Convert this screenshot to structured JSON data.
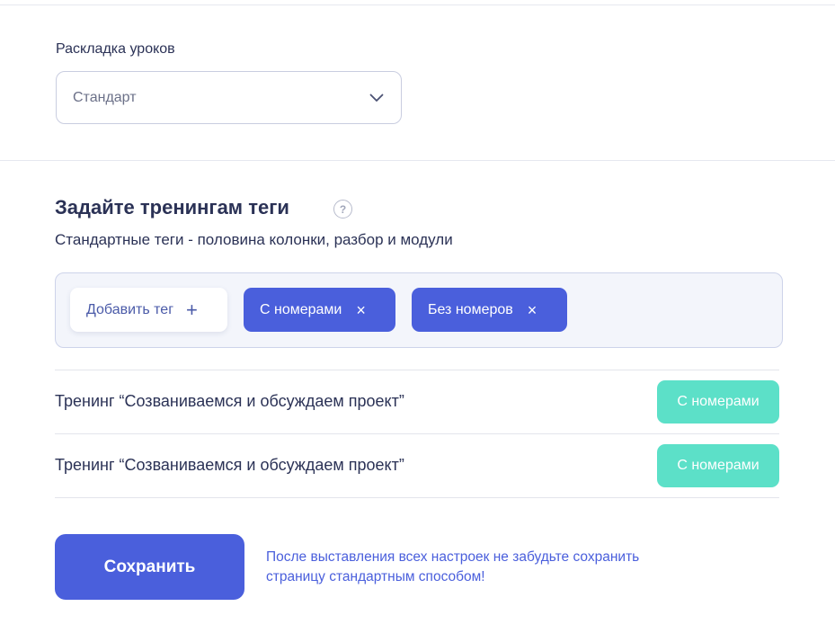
{
  "layout": {
    "label": "Раскладка уроков",
    "selected": "Стандарт"
  },
  "tags_section": {
    "title": "Задайте тренингам теги",
    "help_symbol": "?",
    "subtitle": "Стандартные теги - половина колонки, разбор и модули",
    "add_tag_label": "Добавить тег",
    "add_symbol": "+",
    "remove_symbol": "×",
    "tags": [
      {
        "label": "С номерами"
      },
      {
        "label": "Без номеров"
      }
    ]
  },
  "trainings": [
    {
      "name": "Тренинг “Созваниваемся и обсуждаем проект”",
      "tag": "С номерами"
    },
    {
      "name": "Тренинг “Созваниваемся и обсуждаем проект”",
      "tag": "С номерами"
    }
  ],
  "footer": {
    "save_label": "Сохранить",
    "note": "После выставления всех настроек не забудьте сохранить страницу стандартным способом!"
  },
  "colors": {
    "primary": "#4a5fdc",
    "badge": "#5ce0c8",
    "text": "#2b3256"
  },
  "icons": {
    "dropdown": "chevron-down-icon",
    "help": "question-circle-icon",
    "add": "plus-icon",
    "remove": "close-icon"
  }
}
